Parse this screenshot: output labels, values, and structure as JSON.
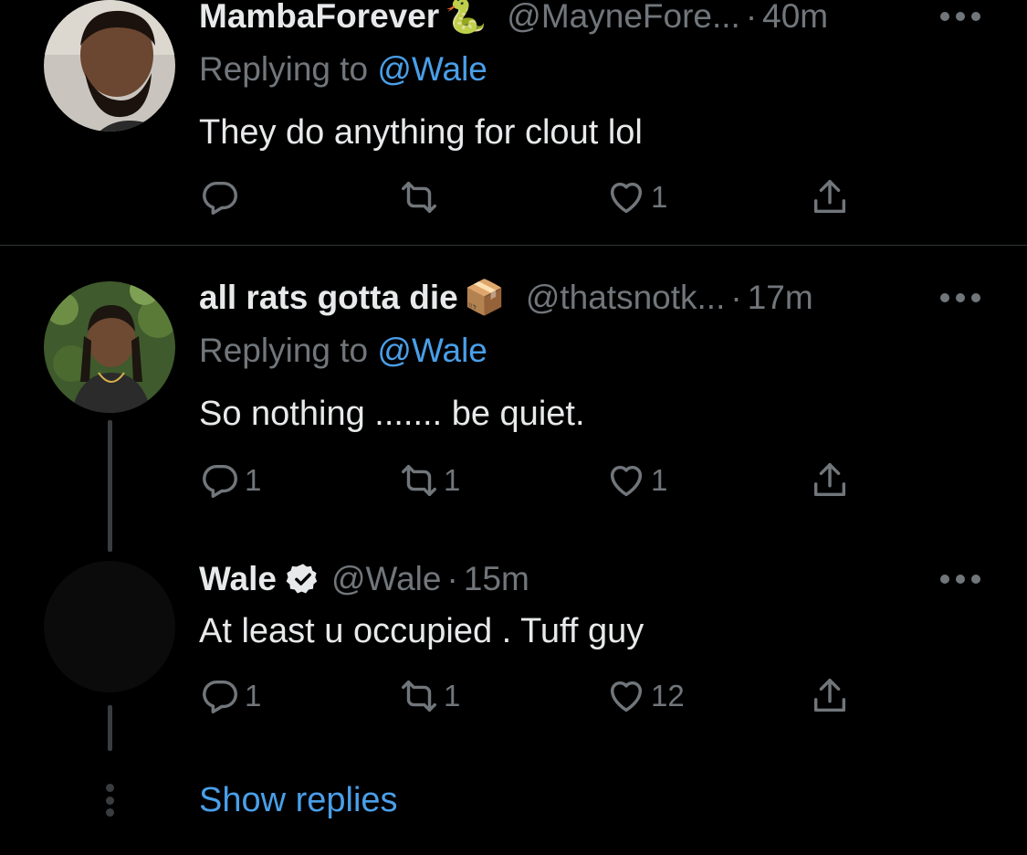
{
  "tweets": [
    {
      "name": "MambaForever",
      "name_emoji": "🐍",
      "handle": "@MayneFore...",
      "time": "40m",
      "replying_prefix": "Replying to ",
      "replying_mention": "@Wale",
      "text": "They do anything for clout lol",
      "reply_count": "",
      "retweet_count": "",
      "like_count": "1"
    },
    {
      "name": "all rats gotta die",
      "name_emoji": "📦",
      "handle": "@thatsnotk...",
      "time": "17m",
      "replying_prefix": "Replying to ",
      "replying_mention": "@Wale",
      "text": "So nothing ....... be quiet.",
      "reply_count": "1",
      "retweet_count": "1",
      "like_count": "1"
    },
    {
      "name": "Wale",
      "verified": true,
      "handle": "@Wale",
      "time": "15m",
      "text": "At least u occupied . Tuff guy",
      "reply_count": "1",
      "retweet_count": "1",
      "like_count": "12"
    }
  ],
  "time_separator": "·",
  "show_replies_label": "Show replies",
  "colors": {
    "background": "#000000",
    "text": "#e7e9ea",
    "secondary": "#71767b",
    "link": "#4a9fe9",
    "divider": "#2f3336"
  },
  "icons": [
    "reply-icon",
    "retweet-icon",
    "like-icon",
    "share-icon",
    "more-icon",
    "verified-badge-icon"
  ]
}
